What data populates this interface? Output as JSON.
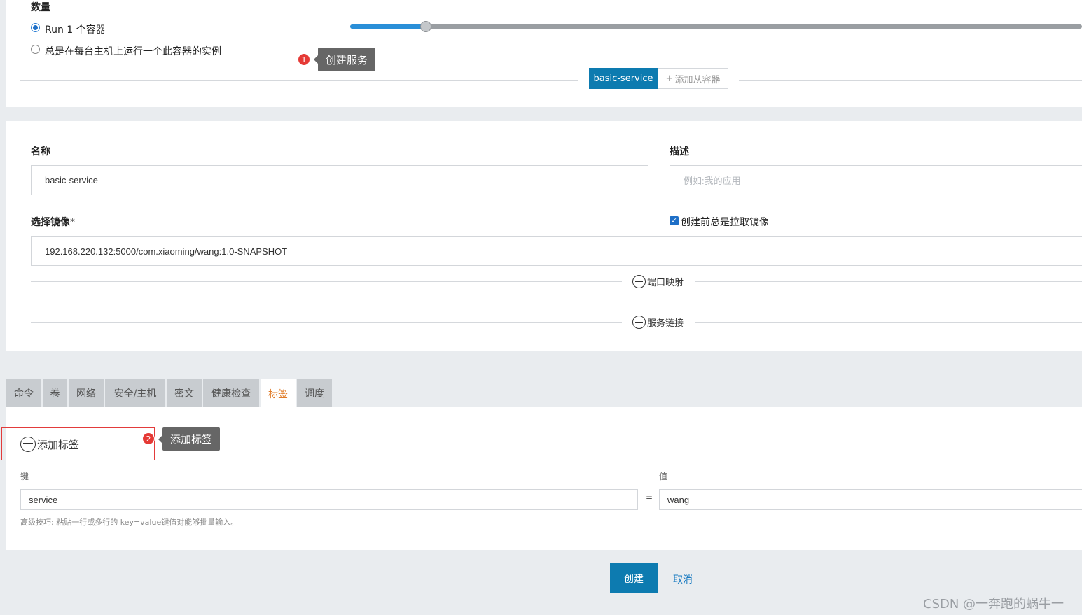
{
  "scale": {
    "label": "数量",
    "option_run": "Run 1 个容器",
    "option_always": "总是在每台主机上运行一个此容器的实例",
    "slider_value": 1
  },
  "tooltips": {
    "create_service": {
      "badge": "1",
      "text": "创建服务"
    },
    "add_label": {
      "badge": "2",
      "text": "添加标签"
    }
  },
  "container_tabs": {
    "active": "basic-service",
    "add_sidekick": "添加从容器"
  },
  "form": {
    "name_label": "名称",
    "name_value": "basic-service",
    "desc_label": "描述",
    "desc_placeholder": "例如:我的应用",
    "image_label": "选择镜像",
    "image_required": "*",
    "image_value": "192.168.220.132:5000/com.xiaoming/wang:1.0-SNAPSHOT",
    "pull_image_label": "创建前总是拉取镜像",
    "port_mapping": "端口映射",
    "service_links": "服务链接"
  },
  "tabs": [
    {
      "label": "命令"
    },
    {
      "label": "卷"
    },
    {
      "label": "网络"
    },
    {
      "label": "安全/主机"
    },
    {
      "label": "密文"
    },
    {
      "label": "健康检查"
    },
    {
      "label": "标签"
    },
    {
      "label": "调度"
    }
  ],
  "labels_section": {
    "add_label": "添加标签",
    "key_header": "键",
    "value_header": "值",
    "separator": "=",
    "key_value": "service",
    "value_value": "wang",
    "hint": "高级技巧: 粘贴一行或多行的 key=value键值对能够批量输入。"
  },
  "actions": {
    "create": "创建",
    "cancel": "取消"
  },
  "watermark": "CSDN @一奔跑的蜗牛一",
  "colors": {
    "primary": "#0d7bb0",
    "active_tab": "#e07b27",
    "badge": "#e53935",
    "tooltip": "#666666"
  }
}
